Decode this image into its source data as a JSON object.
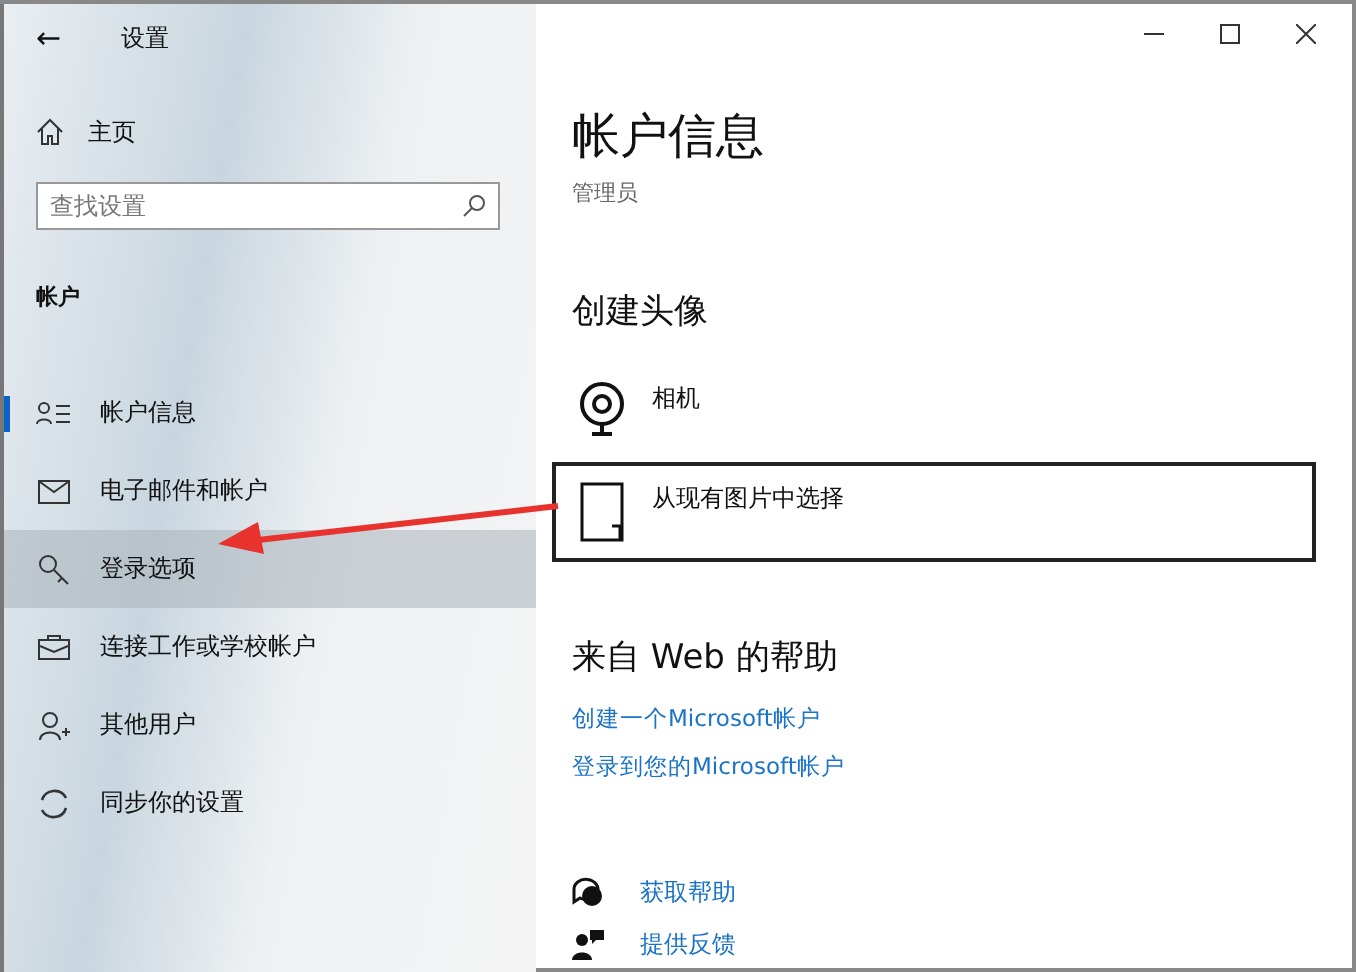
{
  "window": {
    "title": "设置",
    "back": "←"
  },
  "sidebar": {
    "home": "主页",
    "search": {
      "placeholder": "查找设置"
    },
    "section": "帐户",
    "items": [
      {
        "label": "帐户信息",
        "selected": true,
        "highlighted": false
      },
      {
        "label": "电子邮件和帐户",
        "selected": false,
        "highlighted": false
      },
      {
        "label": "登录选项",
        "selected": false,
        "highlighted": true
      },
      {
        "label": "连接工作或学校帐户",
        "selected": false,
        "highlighted": false
      },
      {
        "label": "其他用户",
        "selected": false,
        "highlighted": false
      },
      {
        "label": "同步你的设置",
        "selected": false,
        "highlighted": false
      }
    ]
  },
  "content": {
    "title": "帐户信息",
    "role": "管理员",
    "avatar_heading": "创建头像",
    "avatar_options": [
      {
        "label": "相机",
        "focused": false
      },
      {
        "label": "从现有图片中选择",
        "focused": true
      }
    ],
    "help_heading": "来自 Web 的帮助",
    "links": [
      "创建一个Microsoft帐户",
      "登录到您的Microsoft帐户"
    ],
    "actions": [
      "获取帮助",
      "提供反馈"
    ]
  }
}
